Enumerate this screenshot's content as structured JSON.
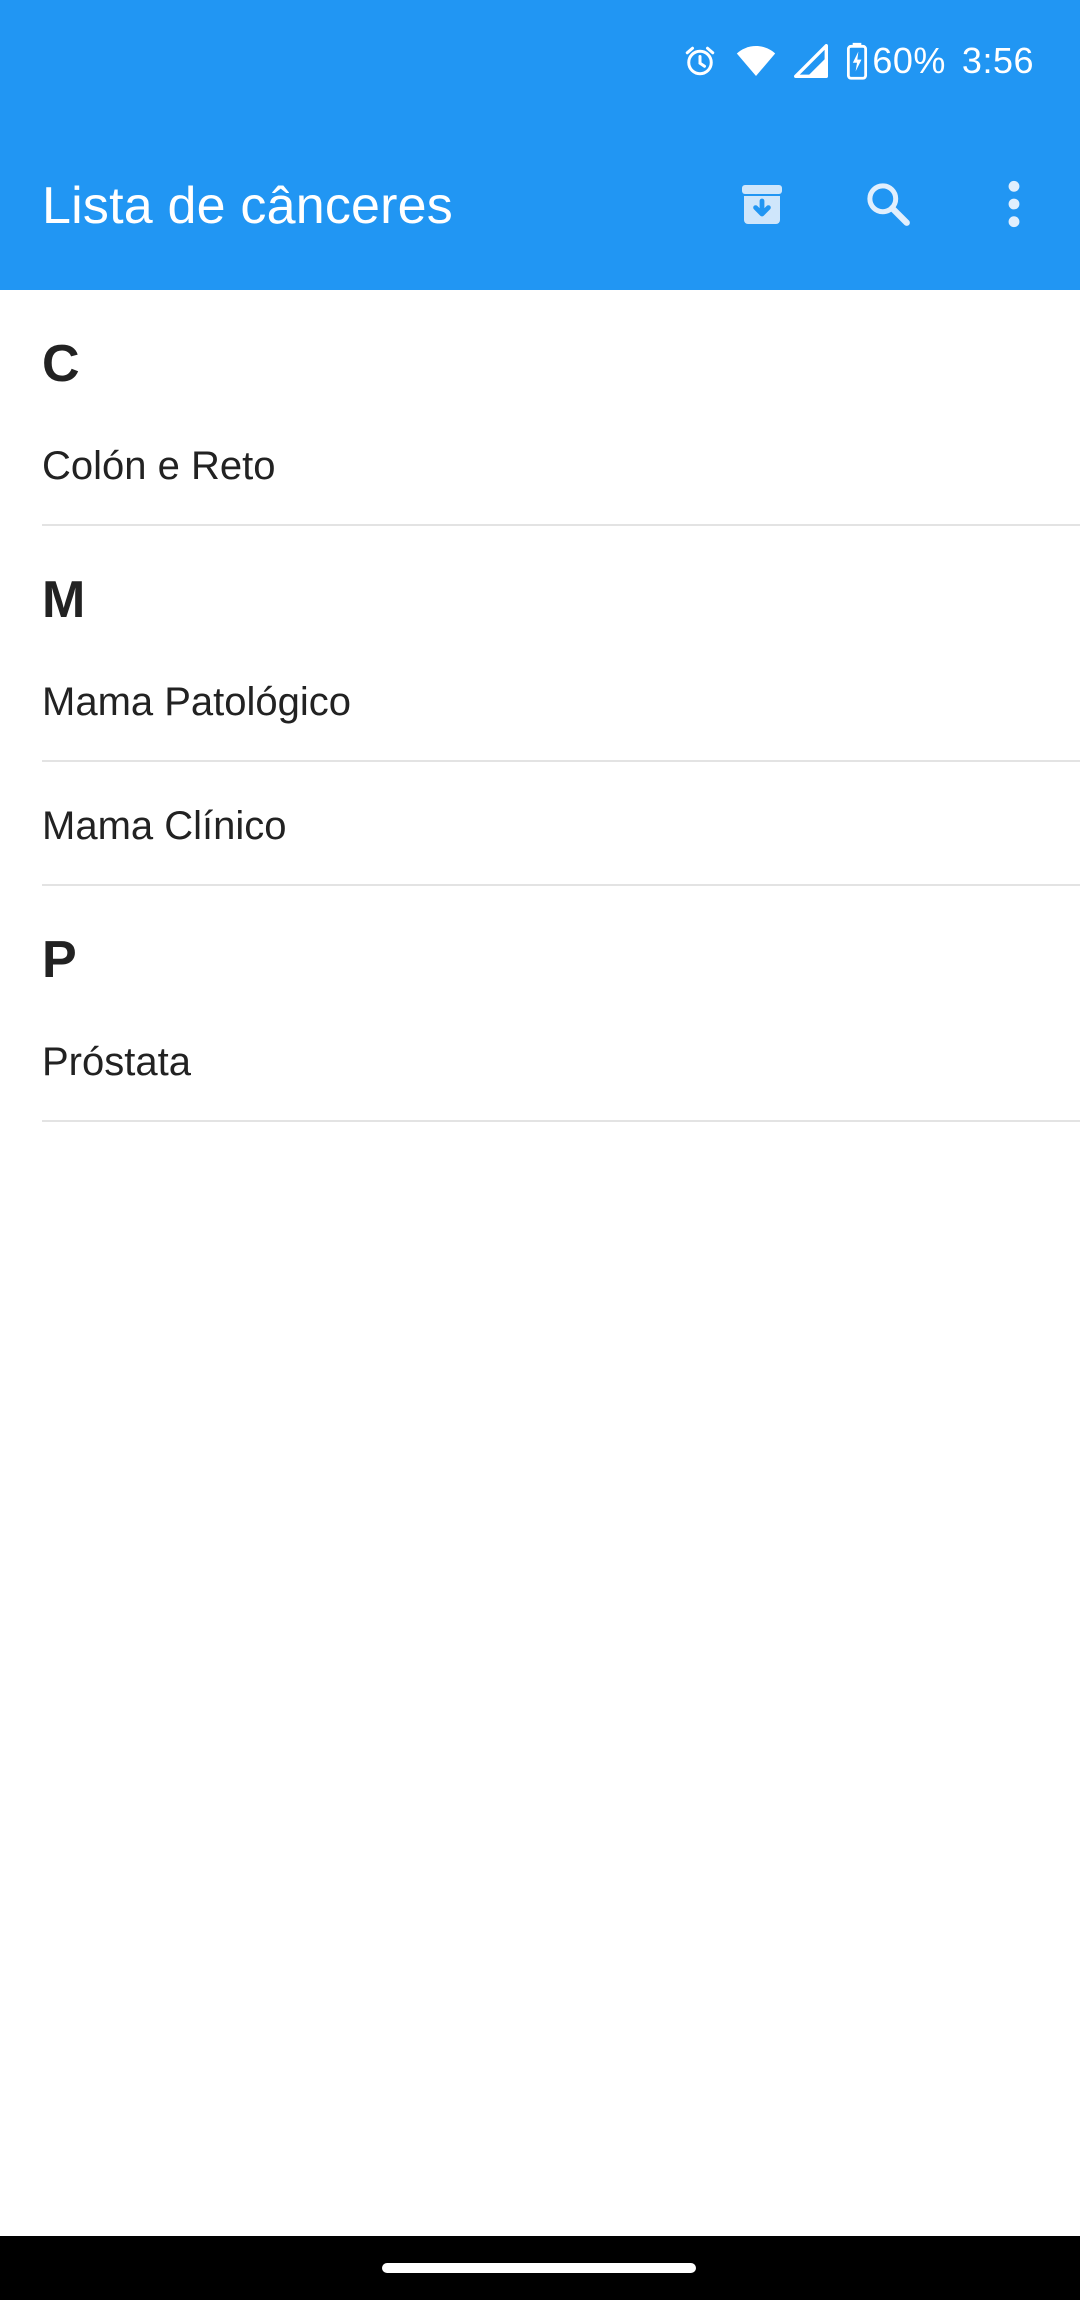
{
  "status_bar": {
    "battery_percent": "60%",
    "time": "3:56",
    "icons": [
      "alarm-icon",
      "wifi-icon",
      "cell-signal-icon",
      "battery-charging-icon"
    ]
  },
  "app_bar": {
    "title": "Lista de cânceres",
    "actions": [
      "archive-download-icon",
      "search-icon",
      "more-vert-icon"
    ],
    "color": "#2196F3"
  },
  "sections": [
    {
      "letter": "C",
      "items": [
        "Colón e Reto"
      ]
    },
    {
      "letter": "M",
      "items": [
        "Mama Patológico",
        "Mama Clínico"
      ]
    },
    {
      "letter": "P",
      "items": [
        "Próstata"
      ]
    }
  ]
}
